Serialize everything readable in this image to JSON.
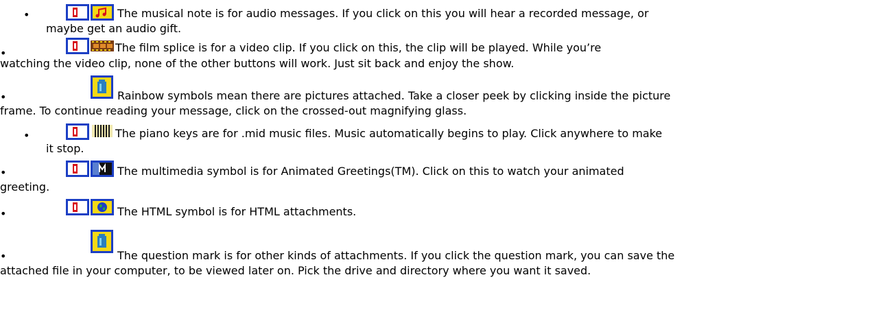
{
  "items": [
    {
      "icons": [
        "page-tab-icon",
        "musical-note-icon"
      ],
      "line1": "The musical note is for audio messages. If you click on this you will hear a recorded message, or",
      "line2": "maybe get an audio gift."
    },
    {
      "icons": [
        "page-tab-icon",
        "film-splice-icon"
      ],
      "line1": "The film splice is for a video clip. If you click on this, the clip will be played. While you’re",
      "line2": "watching the video clip, none of the other buttons will work. Just sit back and enjoy the show."
    },
    {
      "icons": [
        "rainbow-picture-icon"
      ],
      "line1": "Rainbow symbols mean there are pictures attached. Take a closer peek by clicking inside the picture",
      "line2": "frame. To continue reading your message, click on the crossed-out magnifying glass."
    },
    {
      "icons": [
        "page-tab-icon",
        "piano-keys-icon"
      ],
      "line1": "The piano keys are for .mid music files. Music automatically begins to play. Click anywhere to make",
      "line2": "it stop."
    },
    {
      "icons": [
        "page-tab-icon",
        "multimedia-icon"
      ],
      "line1": "The multimedia symbol is for Animated Greetings(TM). Click on this to watch your animated",
      "line2": "greeting."
    },
    {
      "icons": [
        "page-tab-icon",
        "html-globe-icon"
      ],
      "line1": "The HTML symbol is for HTML attachments.",
      "line2": ""
    },
    {
      "icons": [
        "question-mark-icon"
      ],
      "line1": "The question mark is for other kinds of attachments. If you click the question mark, you can save the",
      "line2": "attached file in your computer, to be viewed later on. Pick the drive and directory where you want it saved."
    }
  ],
  "bullet": "•",
  "colors": {
    "icon_blue": "#1c3fc4",
    "icon_red": "#d8121b",
    "icon_yellow": "#f5d915"
  }
}
